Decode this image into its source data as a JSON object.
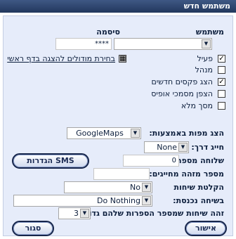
{
  "window": {
    "title": "משתמש חדש"
  },
  "form": {
    "username_label": "משתמש",
    "username_value": "",
    "password_label": "סיסמה",
    "password_value": "****",
    "active_label": "פעיל",
    "active_checked": true,
    "home_modules_label": "בחירת מודולים להצגה בדף ראשי",
    "admin_label": "מנהל",
    "admin_checked": false,
    "show_new_faxes_label": "הצג פקסים חדשים",
    "show_new_faxes_checked": true,
    "encrypt_office_docs_label": "הצפן מסמכי אופיס",
    "encrypt_office_docs_checked": false,
    "fullscreen_label": "מסך מלא",
    "fullscreen_checked": false,
    "maps_label": "הצג מפות באמצעות:",
    "maps_value": "GoogleMaps",
    "route_label": "חייג דרך:",
    "route_value": "None",
    "extension_label": "שלוחה מספר:",
    "extension_value": "0",
    "caller_id_label": "מספר מזהה מחייגים:",
    "caller_id_value": "",
    "record_calls_label": "הקלטת שיחות",
    "record_calls_value": "No",
    "incoming_call_label": "בשיחה נכנסת:",
    "incoming_call_value": "Do Nothing",
    "min_digits_label": "זהה שיחות שמספר הספרות שלהם גדול מ:",
    "min_digits_value": "3"
  },
  "buttons": {
    "sms_settings": "הגדרות SMS",
    "ok": "אישור",
    "close": "סגור"
  }
}
